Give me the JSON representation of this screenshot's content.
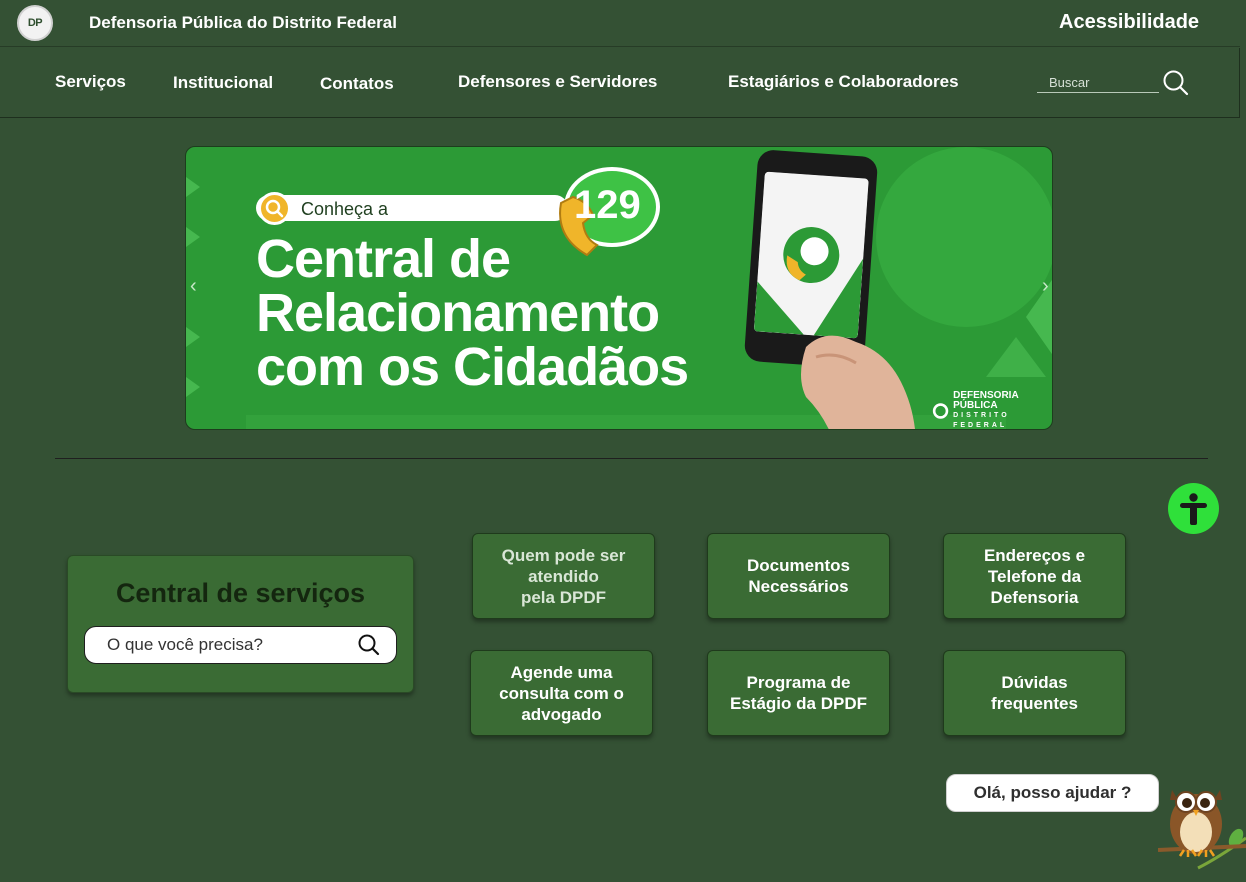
{
  "header": {
    "logo_text": "DP",
    "title": "Defensoria Pública do Distrito Federal",
    "accessibility_label": "Acessibilidade"
  },
  "nav": {
    "items": [
      {
        "label": "Serviços"
      },
      {
        "label": "Institucional"
      },
      {
        "label": "Contatos"
      },
      {
        "label": "Defensores e Servidores"
      },
      {
        "label": "Estagiários e Colaboradores"
      }
    ],
    "search_placeholder": "Buscar",
    "search_icon": "search-icon"
  },
  "banner": {
    "tag": "Conheça a",
    "line1": "Central de",
    "line2": "Relacionamento",
    "line3": "com os Cidadãos",
    "number": "129",
    "footer_logo_line1": "DEFENSORIA PÚBLICA",
    "footer_logo_line2": "DISTRITO FEDERAL",
    "prev_icon": "chevron-left-icon",
    "next_icon": "chevron-right-icon",
    "colors": {
      "green": "#2c9a36",
      "accent": "#f0b52a"
    }
  },
  "services": {
    "title": "Central de serviços",
    "search_placeholder": "O que você precisa?"
  },
  "tiles": [
    {
      "label": "Quem pode ser\natendido\npela DPDF"
    },
    {
      "label": "Documentos\nNecessários"
    },
    {
      "label": "Endereços e\nTelefone da\nDefensoria"
    },
    {
      "label": "Agende uma\nconsulta com o\nadvogado"
    },
    {
      "label": "Programa de\nEstágio da DPDF"
    },
    {
      "label": "Dúvidas\nfrequentes"
    }
  ],
  "chat": {
    "label": "Olá, posso ajudar ?",
    "mascot": "owl-icon"
  },
  "accessibility_fab": {
    "icon": "accessibility-icon",
    "color": "#2fe03a"
  },
  "theme": {
    "background": "#345134",
    "tile": "#3a6b34"
  }
}
